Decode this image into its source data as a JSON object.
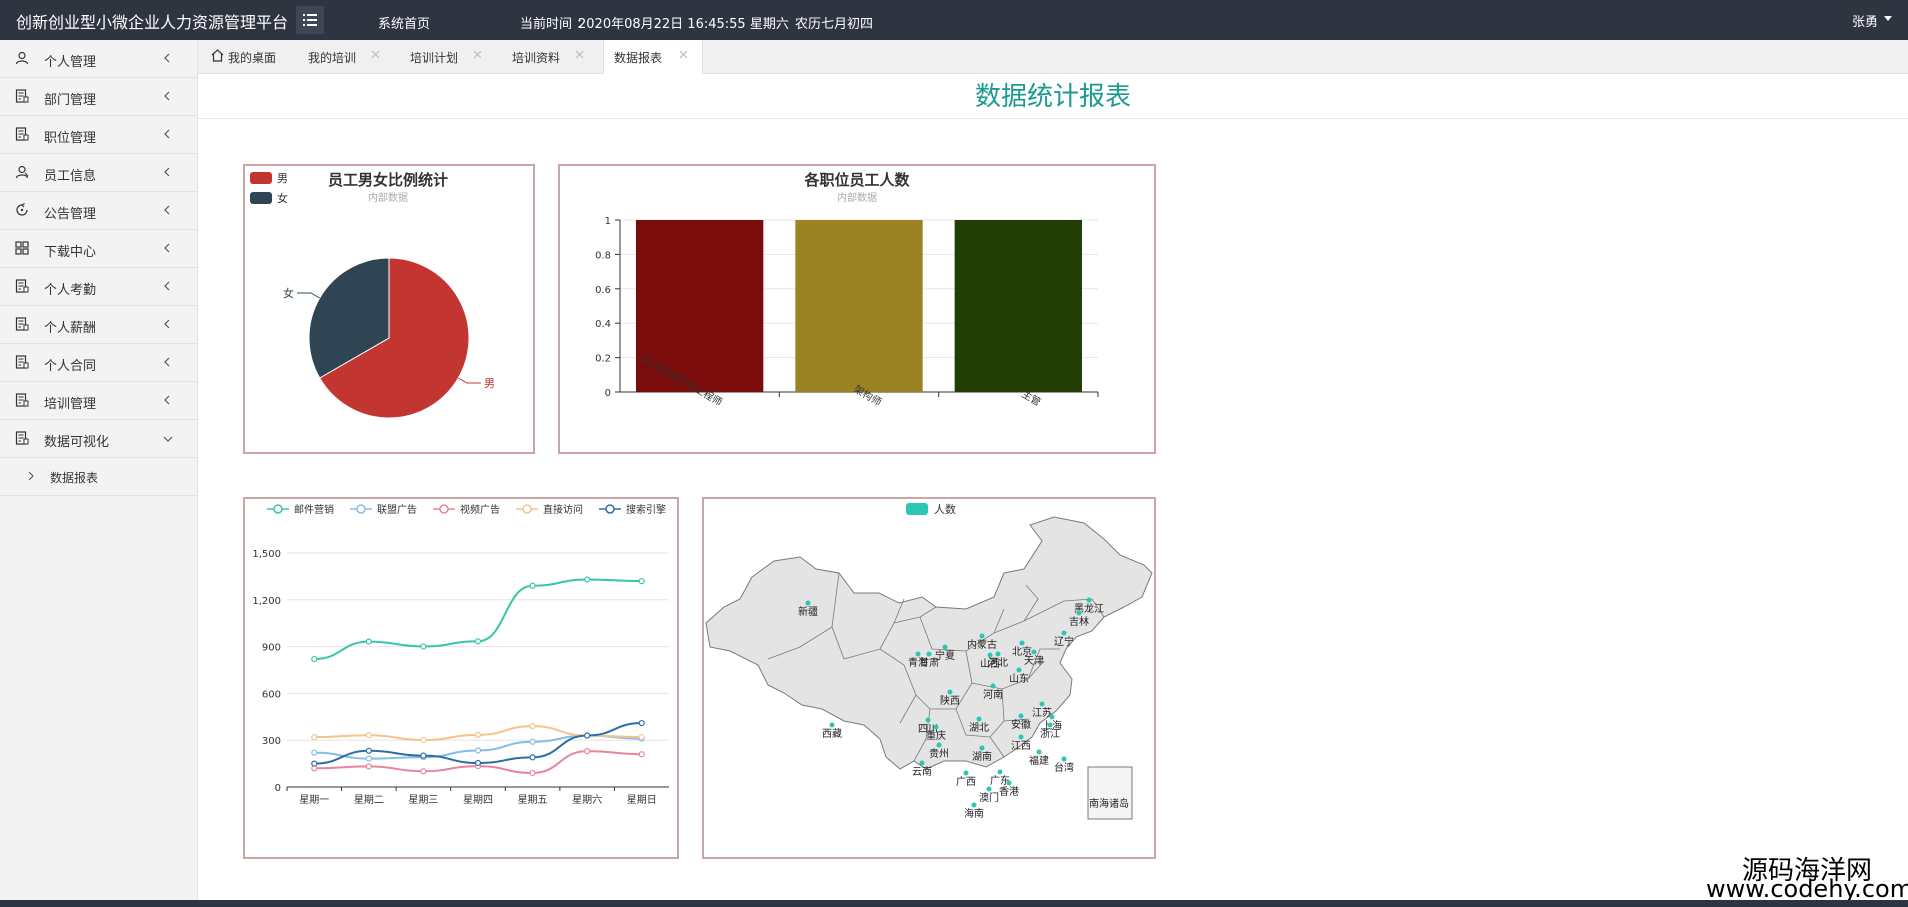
{
  "header": {
    "brand": "创新创业型小微企业人力资源管理平台",
    "home": "系统首页",
    "time_label": "当前时间 ：",
    "time_value": "2020年08月22日 16:45:55 星期六",
    "lunar": "农历七月初四",
    "user": "张勇"
  },
  "sidebar": {
    "items": [
      {
        "label": "个人管理",
        "icon": "user-icon"
      },
      {
        "label": "部门管理",
        "icon": "document-icon"
      },
      {
        "label": "职位管理",
        "icon": "document-icon"
      },
      {
        "label": "员工信息",
        "icon": "users-icon"
      },
      {
        "label": "公告管理",
        "icon": "refresh-icon"
      },
      {
        "label": "下载中心",
        "icon": "grid-icon"
      },
      {
        "label": "个人考勤",
        "icon": "document-icon"
      },
      {
        "label": "个人薪酬",
        "icon": "document-icon"
      },
      {
        "label": "个人合同",
        "icon": "document-icon"
      },
      {
        "label": "培训管理",
        "icon": "document-icon"
      },
      {
        "label": "数据可视化",
        "icon": "document-icon"
      }
    ],
    "sub_item": "数据报表"
  },
  "tabs": [
    {
      "label": "我的桌面"
    },
    {
      "label": "我的培训"
    },
    {
      "label": "培训计划"
    },
    {
      "label": "培训资料"
    },
    {
      "label": "数据报表"
    }
  ],
  "page": {
    "title": "数据统计报表"
  },
  "watermark": {
    "line1": "源码海洋网",
    "line2": "www.codehy.com"
  },
  "colors": {
    "accent": "#1b9a8f",
    "header_bg": "#2f3441",
    "panel_border": "#c9a7a6"
  },
  "chart_data": [
    {
      "type": "pie",
      "title": "员工男女比例统计",
      "subtitle": "内部数据",
      "legend": [
        "男",
        "女"
      ],
      "slices": [
        {
          "name": "男",
          "value": 2,
          "color": "#c23531"
        },
        {
          "name": "女",
          "value": 1,
          "color": "#2f4554"
        }
      ]
    },
    {
      "type": "bar",
      "title": "各职位员工人数",
      "subtitle": "内部数据",
      "categories": [
        "Java中级开发工程师",
        "架构师",
        "主管"
      ],
      "values": [
        1,
        1,
        1
      ],
      "colors": [
        "#7b0c0c",
        "#9b8323",
        "#233d06"
      ],
      "ylim": [
        0,
        1
      ],
      "yticks": [
        "0",
        "0.2",
        "0.4",
        "0.6",
        "0.8",
        "1"
      ]
    },
    {
      "type": "line",
      "categories": [
        "星期一",
        "星期二",
        "星期三",
        "星期四",
        "星期五",
        "星期六",
        "星期日"
      ],
      "ylim": [
        0,
        1500
      ],
      "yticks": [
        "0",
        "300",
        "600",
        "900",
        "1,200",
        "1,500"
      ],
      "series": [
        {
          "name": "邮件营销",
          "values": [
            820,
            932,
            901,
            934,
            1290,
            1330,
            1320
          ],
          "color": "#37c6a9"
        },
        {
          "name": "联盟广告",
          "values": [
            220,
            182,
            191,
            234,
            290,
            330,
            310
          ],
          "color": "#85bde4"
        },
        {
          "name": "视频广告",
          "values": [
            120,
            132,
            101,
            134,
            90,
            230,
            210
          ],
          "color": "#e8859a"
        },
        {
          "name": "直接访问",
          "values": [
            320,
            332,
            301,
            334,
            390,
            330,
            320
          ],
          "color": "#f4c48a"
        },
        {
          "name": "搜索引擎",
          "values": [
            150,
            232,
            201,
            154,
            190,
            330,
            410
          ],
          "color": "#2e6ea5"
        }
      ]
    },
    {
      "type": "map",
      "legend": [
        "人数"
      ],
      "legend_color": "#2cc7b4",
      "regions": [
        "新疆",
        "西藏",
        "青海",
        "甘肃",
        "宁夏",
        "内蒙古",
        "黑龙江",
        "吉林",
        "辽宁",
        "北京",
        "天津",
        "河北",
        "山西",
        "山东",
        "河南",
        "陕西",
        "四川",
        "重庆",
        "湖北",
        "湖南",
        "安徽",
        "江苏",
        "上海",
        "浙江",
        "江西",
        "福建",
        "台湾",
        "贵州",
        "云南",
        "广西",
        "广东",
        "香港",
        "澳门",
        "海南",
        "南海诸岛"
      ]
    }
  ]
}
